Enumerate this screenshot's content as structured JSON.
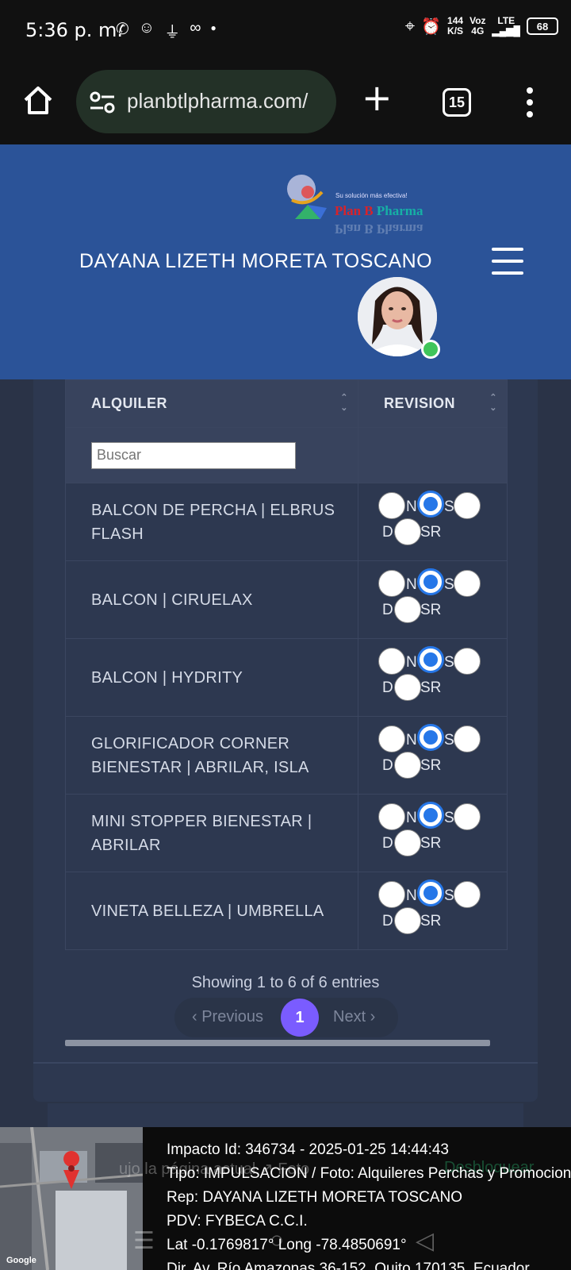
{
  "status_bar": {
    "time": "5:36 p. m.",
    "net_speed": "144",
    "net_unit": "K/S",
    "network": "4G",
    "voz": "Voz",
    "lte": "LTE",
    "battery": "68"
  },
  "browser": {
    "url": "planbtlpharma.com/",
    "tab_count": "15"
  },
  "header": {
    "logo_tagline": "Su solución más efectiva!",
    "logo_name_1": "Plan B",
    "logo_name_2": "Pharma",
    "user_name": "DAYANA LIZETH MORETA TOSCANO"
  },
  "table": {
    "col1": "ALQUILER",
    "col2": "REVISION",
    "search_placeholder": "Buscar",
    "radio_labels": [
      "N",
      "S",
      "D",
      "SR"
    ],
    "rows": [
      {
        "label": "BALCON DE PERCHA | ELBRUS FLASH",
        "selected": "S"
      },
      {
        "label": "BALCON | CIRUELAX",
        "selected": "S"
      },
      {
        "label": "BALCON | HYDRITY",
        "selected": "S"
      },
      {
        "label": "GLORIFICADOR CORNER BIENESTAR | ABRILAR, ISLA",
        "selected": "S"
      },
      {
        "label": "MINI STOPPER BIENESTAR | ABRILAR",
        "selected": "S"
      },
      {
        "label": "VINETA BELLEZA | UMBRELLA",
        "selected": "S"
      }
    ]
  },
  "pagination": {
    "summary": "Showing 1 to 6 of 6 entries",
    "prev": "Previous",
    "current": "1",
    "next": "Next"
  },
  "overlay": {
    "ghost_text": "ujo la página actual  ↗ Foto",
    "ghost_text_2": "Desbloquear",
    "line1": "Impacto Id: 346734 - 2025-01-25 14:44:43",
    "line2": "Tipo: IMPULSACION / Foto: Alquileres Perchas y Promociones",
    "line3": "Rep: DAYANA LIZETH MORETA TOSCANO",
    "line4": "PDV: FYBECA C.C.I.",
    "line5": "Lat -0.1769817° Long -78.4850691°",
    "line6": "Dir. Av. Río Amazonas 36-152, Quito 170135, Ecuador",
    "map_credit": "Google"
  }
}
